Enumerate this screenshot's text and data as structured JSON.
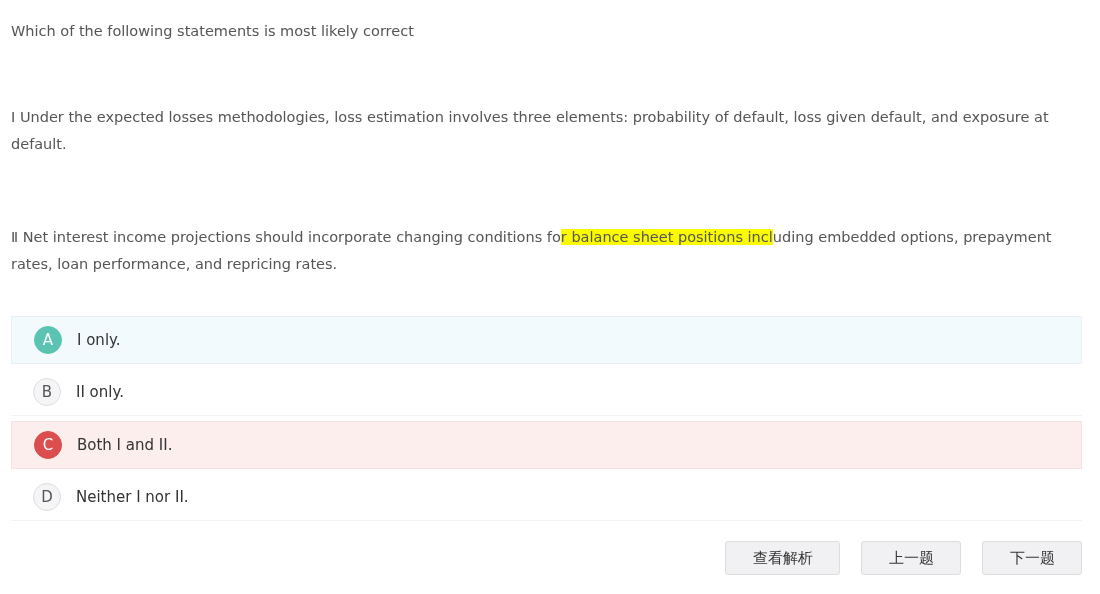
{
  "question": "Which of the following statements is most likely correct",
  "statements": [
    {
      "segments": [
        {
          "text": "Ⅰ Under the expected losses methodologies, loss estimation involves three elements: probability of default, loss given default, and exposure at default.",
          "highlighted": false
        }
      ]
    },
    {
      "segments": [
        {
          "text": "Ⅱ Net interest income projections should incorporate changing conditions fo",
          "highlighted": false
        },
        {
          "text": "r balance sheet positions incl",
          "highlighted": true
        },
        {
          "text": "uding embedded options, prepayment rates, loan performance, and repricing rates.",
          "highlighted": false
        }
      ]
    }
  ],
  "options": [
    {
      "letter": "A",
      "text": "I only.",
      "correct": true,
      "selected": false
    },
    {
      "letter": "B",
      "text": "II only.",
      "correct": false,
      "selected": false
    },
    {
      "letter": "C",
      "text": "Both I and II.",
      "correct": false,
      "selected": true
    },
    {
      "letter": "D",
      "text": "Neither I nor II.",
      "correct": false,
      "selected": false
    }
  ],
  "buttons": [
    "查看解析",
    "上一题",
    "下一题"
  ]
}
